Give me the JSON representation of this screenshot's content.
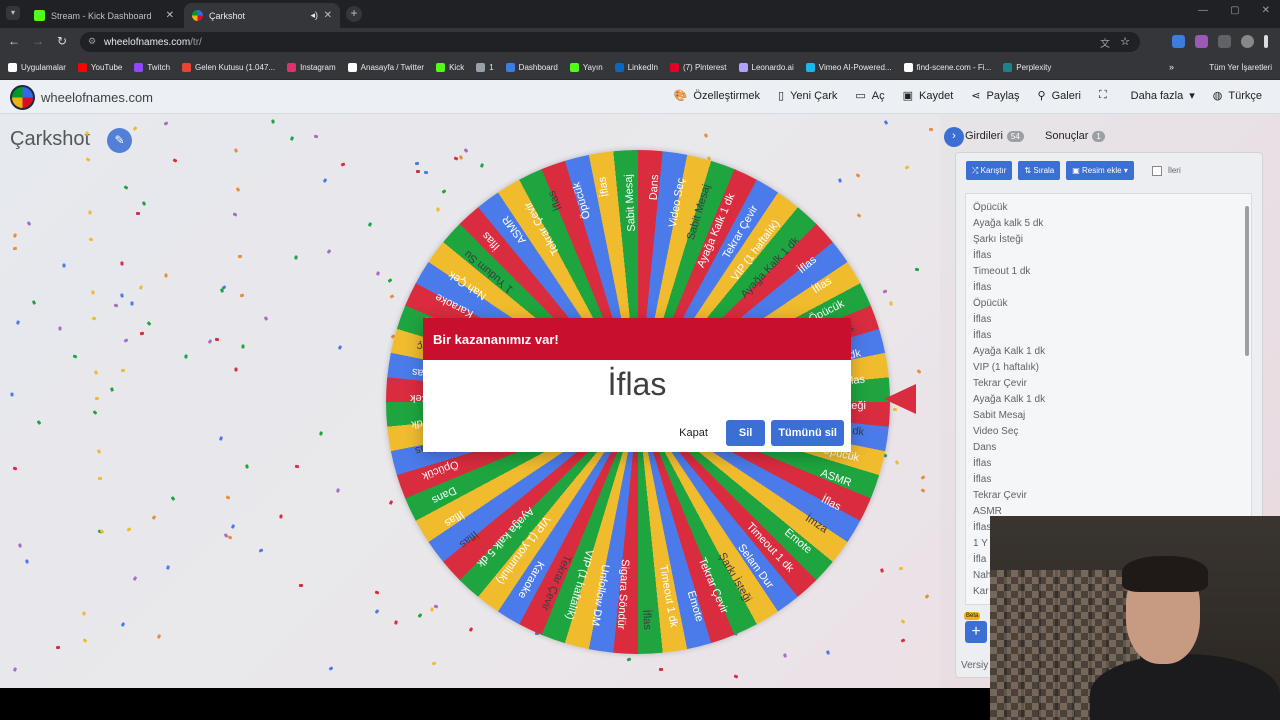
{
  "browser": {
    "tabs": [
      {
        "title": "Stream - Kick Dashboard",
        "active": false,
        "favicon_color": "#53fc18"
      },
      {
        "title": "Çarkshot",
        "active": true,
        "favicon_color": "#3369e8"
      }
    ],
    "url_host": "wheelofnames.com",
    "url_path": "/tr/",
    "bookmarks": [
      {
        "label": "Uygulamalar",
        "icon_color": "#ffffff"
      },
      {
        "label": "YouTube",
        "icon_color": "#ff0000"
      },
      {
        "label": "Twitch",
        "icon_color": "#9146ff"
      },
      {
        "label": "Gelen Kutusu (1.047...",
        "icon_color": "#ea4335"
      },
      {
        "label": "Instagram",
        "icon_color": "#e1306c"
      },
      {
        "label": "Anasayfa / Twitter",
        "icon_color": "#ffffff"
      },
      {
        "label": "Kick",
        "icon_color": "#53fc18"
      },
      {
        "label": "1",
        "icon_color": "#9aa0a6"
      },
      {
        "label": "Dashboard",
        "icon_color": "#3c7ee0"
      },
      {
        "label": "Yayın",
        "icon_color": "#53fc18"
      },
      {
        "label": "LinkedIn",
        "icon_color": "#0a66c2"
      },
      {
        "label": "(7) Pinterest",
        "icon_color": "#e60023"
      },
      {
        "label": "Leonardo.ai",
        "icon_color": "#b0a0ff"
      },
      {
        "label": "Vimeo AI-Powered...",
        "icon_color": "#1ab7ea"
      },
      {
        "label": "find-scene.com - Fi...",
        "icon_color": "#ffffff"
      },
      {
        "label": "Perplexity",
        "icon_color": "#20808d"
      }
    ],
    "bookmarks_more": "»",
    "all_bookmarks": "Tüm Yer İşaretleri"
  },
  "header": {
    "logo_text": "wheelofnames.com",
    "menu": [
      {
        "label": "Özelleştirmek",
        "icon": "palette-icon",
        "glyph": "🎨"
      },
      {
        "label": "Yeni Çark",
        "icon": "document-icon",
        "glyph": "▯"
      },
      {
        "label": "Aç",
        "icon": "folder-icon",
        "glyph": "▭"
      },
      {
        "label": "Kaydet",
        "icon": "save-icon",
        "glyph": "▣"
      },
      {
        "label": "Paylaş",
        "icon": "share-icon",
        "glyph": "⋖"
      },
      {
        "label": "Galeri",
        "icon": "search-icon",
        "glyph": "⚲"
      },
      {
        "label": "",
        "icon": "fullscreen-icon",
        "glyph": "⛶"
      },
      {
        "label": "Daha fazla",
        "icon": "chevron-down-icon",
        "glyph": "▾"
      },
      {
        "label": "Türkçe",
        "icon": "globe-icon",
        "glyph": "◍"
      }
    ]
  },
  "wheel": {
    "title": "Çarkshot",
    "segments": [
      "Dans",
      "Video Seç",
      "Sabit Mesaj",
      "Ayağa Kalk 1 dk",
      "Tekrar Çevir",
      "VIP (1 haftalık)",
      "Ayağa Kalk 1 dk",
      "İflas",
      "İflas",
      "Öpücük",
      "İflas",
      "Timeout 1 dk",
      "İflas",
      "Şarkı İsteği",
      "Ayağa kalk 5 dk",
      "Öpücük",
      "ASMR",
      "İflas",
      "İmza",
      "Emote",
      "Timeout 1 dk",
      "Selam Dur",
      "Şarkı İsteği",
      "Tekrar Çevir",
      "Emote",
      "Timeout 1 dk",
      "İflas",
      "Sigara Söndür",
      "Unfollow DM",
      "VIP (1 haftalık)",
      "Tekrar Çevir",
      "Karaoke",
      "VIP (1 yorumluk)",
      "Ayağa kalk 5 dk",
      "İflas",
      "İflas",
      "Dans",
      "Öpücük",
      "İflas",
      "Timeout 1 dk",
      "Klip Çek",
      "İflas",
      "Video Seç",
      "Klip Çek",
      "Karaoke",
      "Nah Çek",
      "1 Yudum Su",
      "İflas",
      "ASMR",
      "Tekrar Çevir",
      "İflas",
      "Öpücük",
      "İflas",
      "Sabit Mesaj"
    ],
    "colors": [
      "#d50f25",
      "#3369e8",
      "#eeb211",
      "#009925"
    ],
    "visible_texts": [
      "Dans",
      "Video Seç",
      "Sabit Mesaj",
      "Ayağa Kalk 1 dk",
      "Tekrar Çevir",
      "VIP (1 haftalık)",
      "Ayağa Kalk 1 dk",
      "Öpücük",
      "İflas",
      "ut 1 dk",
      "İflas",
      "Ayağa kalk 5 dk",
      "Öpücük",
      "ASMR",
      "İflas",
      "İmza",
      "Emote",
      "Timeout 1 dk",
      "Selam Dur",
      "Şarkı İsteği",
      "Tekrar Çevir",
      "Emote",
      "Timeout 1 dk",
      "İflas",
      "Sigara Söndür",
      "Unfollow DM",
      "VIP (1 haftalık)",
      "Tekrar Çevir",
      "Karaoke",
      "VIP (1 yorumluk)",
      "Ayağa kalk 5 dk",
      "İflas",
      "İflas",
      "Dans",
      "İflas",
      "Tekrar Çevir",
      "İflas",
      "Klip Çek",
      "Video Seç",
      "Klip Çek",
      "Karaoke",
      "Nah Çek",
      "İflas",
      "1 Yudum Su",
      "İflas",
      "ASMR",
      "Tekrar Çevir",
      "İflas",
      "Dans",
      "Video Seç"
    ]
  },
  "dialog": {
    "title": "Bir kazananımız var!",
    "winner": "İflas",
    "close_label": "Kapat",
    "remove_label": "Sil",
    "remove_all_label": "Tümünü sil",
    "header_color": "#c8102e"
  },
  "panel": {
    "tab_entries_label": "Girdileri",
    "tab_entries_count": "54",
    "tab_results_label": "Sonuçlar",
    "tab_results_count": "1",
    "shuffle_label": "Karıştır",
    "sort_label": "Sırala",
    "add_image_label": "Resim ekle",
    "advanced_label": "İleri",
    "entries": [
      "Öpücük",
      "Ayağa kalk 5 dk",
      "Şarkı İsteği",
      "İflas",
      "Timeout 1 dk",
      "İflas",
      "Öpücük",
      "İflas",
      "İflas",
      "Ayağa Kalk 1 dk",
      "VIP (1 haftalık)",
      "Tekrar Çevir",
      "Ayağa Kalk 1 dk",
      "Sabit Mesaj",
      "Video Seç",
      "Dans",
      "İflas",
      "İflas",
      "Tekrar Çevir",
      "ASMR",
      "İflas",
      "1 Y",
      "İfla",
      "Nah",
      "Kar"
    ],
    "beta_label": "Beta",
    "add_label": "+",
    "version_label": "Versiy"
  },
  "accent_color": "#3b6fd4"
}
